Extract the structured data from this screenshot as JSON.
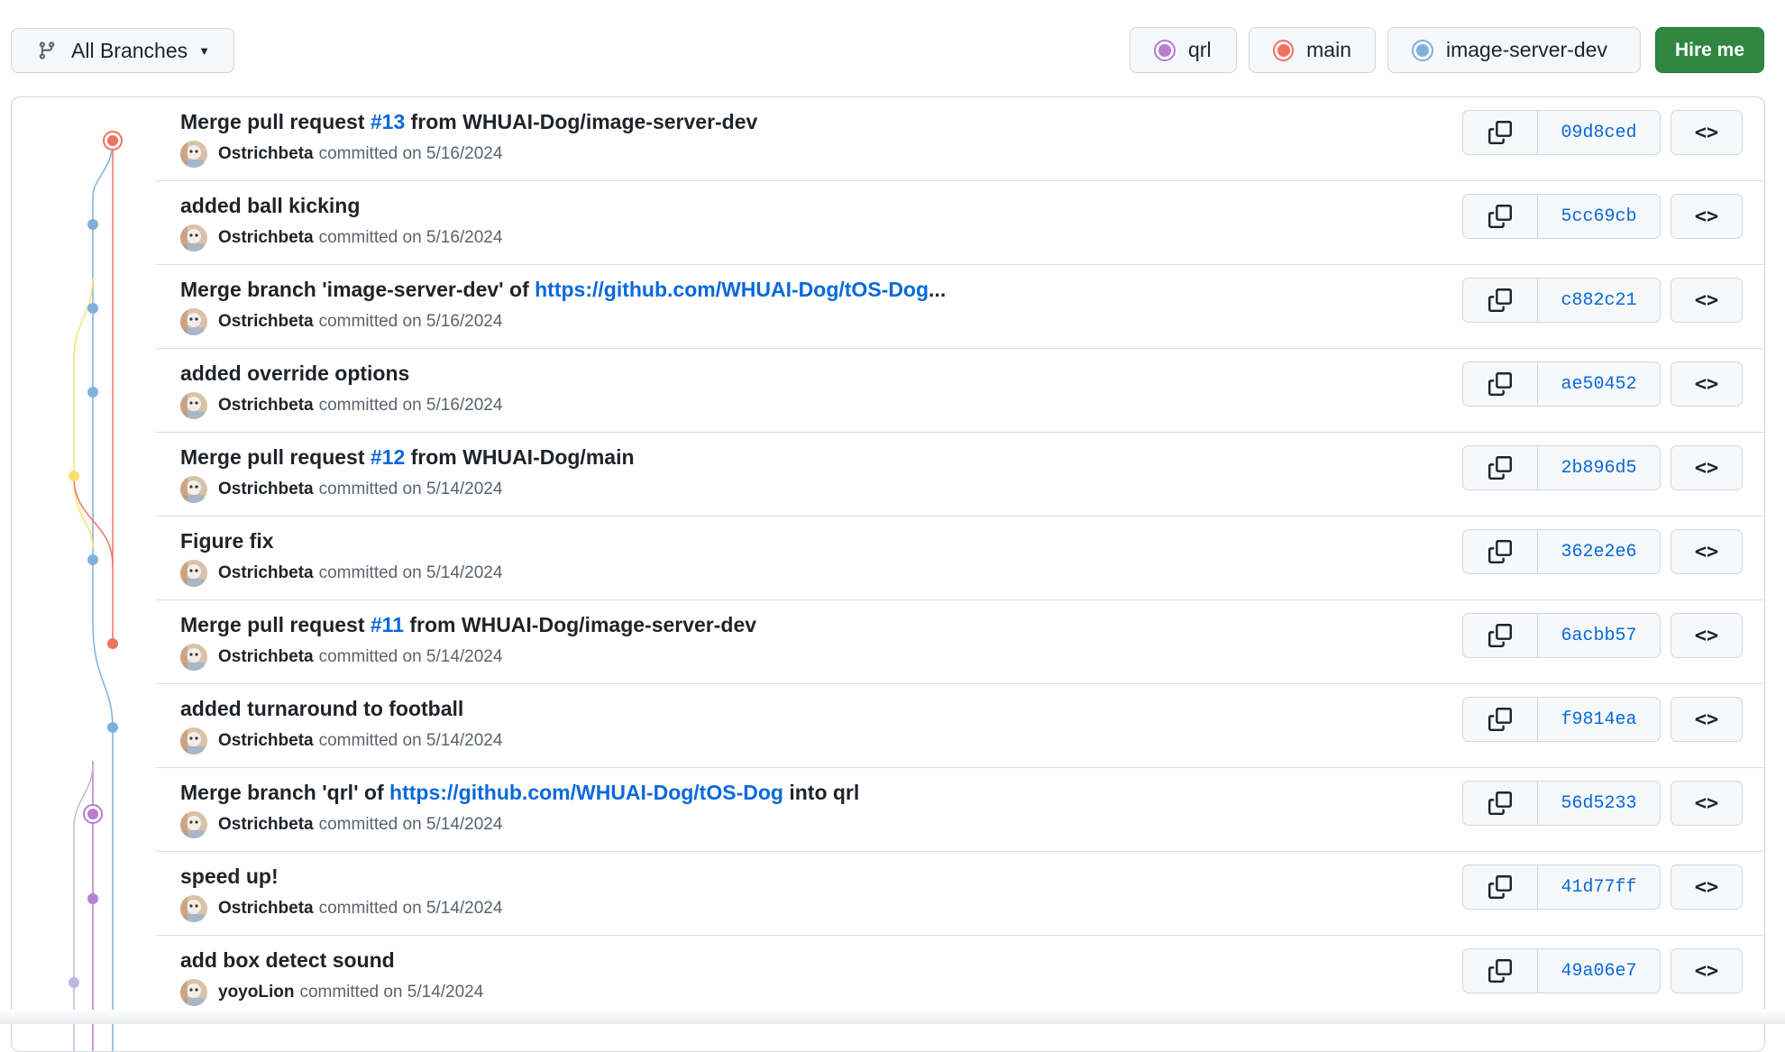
{
  "toolbar": {
    "branch_selector_label": "All Branches",
    "branch_icon": "git-branch-icon",
    "caret_icon": "caret-down-icon",
    "hire_label": "Hire me"
  },
  "branches": [
    {
      "name": "qrl",
      "color": "#b67dd0"
    },
    {
      "name": "main",
      "color": "#f07360"
    },
    {
      "name": "image-server-dev",
      "color": "#7eb0dc"
    }
  ],
  "colors": {
    "accent_link": "#0969da",
    "hire_button": "#2f873f",
    "lane_yellow": "#f6e36f",
    "lane_lavender": "#c1b5e2"
  },
  "commits": [
    {
      "title_prefix": "Merge pull request ",
      "title_link": "#13",
      "title_suffix": " from WHUAI-Dog/image-server-dev",
      "author": "Ostrichbeta",
      "meta": "committed on 5/16/2024",
      "sha": "09d8ced"
    },
    {
      "title_prefix": "added ball kicking",
      "title_link": "",
      "title_suffix": "",
      "author": "Ostrichbeta",
      "meta": "committed on 5/16/2024",
      "sha": "5cc69cb"
    },
    {
      "title_prefix": "Merge branch 'image-server-dev' of ",
      "title_link": "https://github.com/WHUAI-Dog/tOS-Dog",
      "title_suffix": "...",
      "author": "Ostrichbeta",
      "meta": "committed on 5/16/2024",
      "sha": "c882c21"
    },
    {
      "title_prefix": "added override options",
      "title_link": "",
      "title_suffix": "",
      "author": "Ostrichbeta",
      "meta": "committed on 5/16/2024",
      "sha": "ae50452"
    },
    {
      "title_prefix": "Merge pull request ",
      "title_link": "#12",
      "title_suffix": " from WHUAI-Dog/main",
      "author": "Ostrichbeta",
      "meta": "committed on 5/14/2024",
      "sha": "2b896d5"
    },
    {
      "title_prefix": "Figure fix",
      "title_link": "",
      "title_suffix": "",
      "author": "Ostrichbeta",
      "meta": "committed on 5/14/2024",
      "sha": "362e2e6"
    },
    {
      "title_prefix": "Merge pull request ",
      "title_link": "#11",
      "title_suffix": " from WHUAI-Dog/image-server-dev",
      "author": "Ostrichbeta",
      "meta": "committed on 5/14/2024",
      "sha": "6acbb57"
    },
    {
      "title_prefix": "added turnaround to football",
      "title_link": "",
      "title_suffix": "",
      "author": "Ostrichbeta",
      "meta": "committed on 5/14/2024",
      "sha": "f9814ea"
    },
    {
      "title_prefix": "Merge branch 'qrl' of ",
      "title_link": "https://github.com/WHUAI-Dog/tOS-Dog",
      "title_suffix": " into qrl",
      "author": "Ostrichbeta",
      "meta": "committed on 5/14/2024",
      "sha": "56d5233"
    },
    {
      "title_prefix": "speed up!",
      "title_link": "",
      "title_suffix": "",
      "author": "Ostrichbeta",
      "meta": "committed on 5/14/2024",
      "sha": "41d77ff"
    },
    {
      "title_prefix": "add box detect sound",
      "title_link": "",
      "title_suffix": "",
      "author": "yoyoLion",
      "meta": "committed on 5/14/2024",
      "sha": "49a06e7"
    }
  ],
  "row_icons": {
    "copy": "copy-icon",
    "browse": "code-icon"
  },
  "code_glyph": "<>"
}
